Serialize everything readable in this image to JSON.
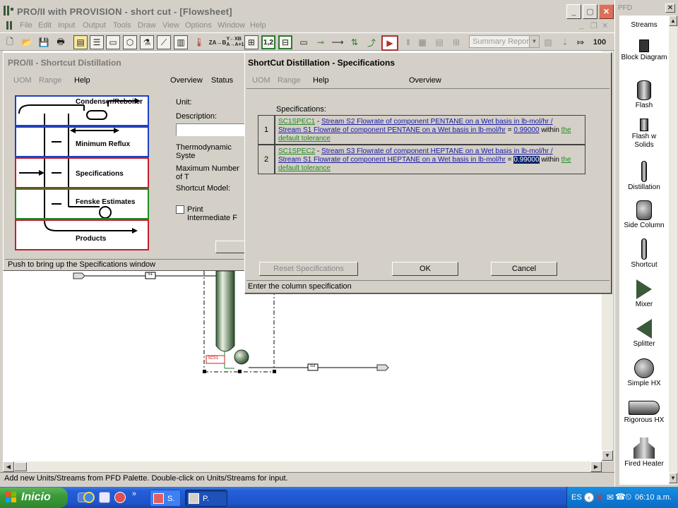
{
  "main_window": {
    "title": "PRO/II with PROVISION - short cut - [Flowsheet]",
    "menu": [
      "File",
      "Edit",
      "Input",
      "Output",
      "Tools",
      "Draw",
      "View",
      "Options",
      "Window",
      "Help"
    ],
    "summary_report_select": "Summary Report",
    "status_text": "Add new Units/Streams from PFD Palette.  Double-click on Units/Streams for input."
  },
  "toolbar": {
    "buttons": [
      "new-file-icon",
      "open-folder-icon",
      "save-icon",
      "print-icon",
      "copy-icon",
      "grid-icon",
      "ruler-icon",
      "component-icon",
      "flask-icon",
      "curve-icon",
      "chart-icon",
      "thermo-icon"
    ],
    "label_za_b": "ZA→B",
    "label_yxb": "Y←XB\nA→A+1",
    "label_1_2": "1,2",
    "label_100": "100"
  },
  "shortcut_window": {
    "title": "PRO/II - Shortcut Distillation",
    "menu": {
      "uom": "UOM",
      "range": "Range",
      "help": "Help",
      "overview": "Overview",
      "status": "Status"
    },
    "sections": {
      "condenser_reboiler": "Condenser/Reboiler",
      "minimum_reflux": "Minimum Reflux",
      "specifications": "Specifications",
      "fenske_estimates": "Fenske Estimates",
      "products": "Products"
    },
    "fields": {
      "unit": "Unit:",
      "description": "Description:",
      "thermo": "Thermodynamic Syste",
      "max_number": "Maximum Number of T",
      "shortcut_model": "Shortcut Model:",
      "print_intermediate": "Print Intermediate F"
    },
    "status_text": "Push to bring up the Specifications window"
  },
  "dialog": {
    "title": "ShortCut Distillation - Specifications",
    "menu": {
      "uom": "UOM",
      "range": "Range",
      "help": "Help",
      "overview": "Overview"
    },
    "spec_label": "Specifications:",
    "specs": [
      {
        "num": "1",
        "name": "SC1SPEC1",
        "dash": " - ",
        "line1": "Stream S2 Flowrate of component PENTANE on a Wet basis in lb-mol/hr",
        "slash": " / ",
        "line2": "Stream S1 Flowrate of component PENTANE on a Wet basis in lb-mol/hr",
        "eq": " = ",
        "value": "0.99000",
        "within": " within ",
        "the": "the",
        "tolerance": "default tolerance"
      },
      {
        "num": "2",
        "name": "SC1SPEC2",
        "dash": " - ",
        "line1": "Stream S3 Flowrate of component HEPTANE on a Wet basis in lb-mol/hr",
        "slash": " / ",
        "line2": "Stream S1 Flowrate of component HEPTANE on a Wet basis in lb-mol/hr",
        "eq": " = ",
        "value": "0.99000",
        "within": " within ",
        "the": "the",
        "tolerance": "default tolerance"
      }
    ],
    "buttons": {
      "reset": "Reset Specifications",
      "ok": "OK",
      "cancel": "Cancel"
    },
    "status_text": "Enter the column specification"
  },
  "flowsheet": {
    "streams": {
      "s1": "S1",
      "s3": "S3"
    },
    "unit_tag": "SC51"
  },
  "pfd_palette": {
    "title": "PFD",
    "items": [
      "Streams",
      "Block Diagram",
      "Flash",
      "Flash w Solids",
      "Distillation",
      "Side Column",
      "Shortcut",
      "Mixer",
      "Splitter",
      "Simple HX",
      "Rigorous HX",
      "Fired Heater"
    ]
  },
  "taskbar": {
    "start_label": "Inicio",
    "tasks": [
      "S.",
      "P."
    ],
    "language": "ES",
    "time": "06:10 a.m."
  }
}
